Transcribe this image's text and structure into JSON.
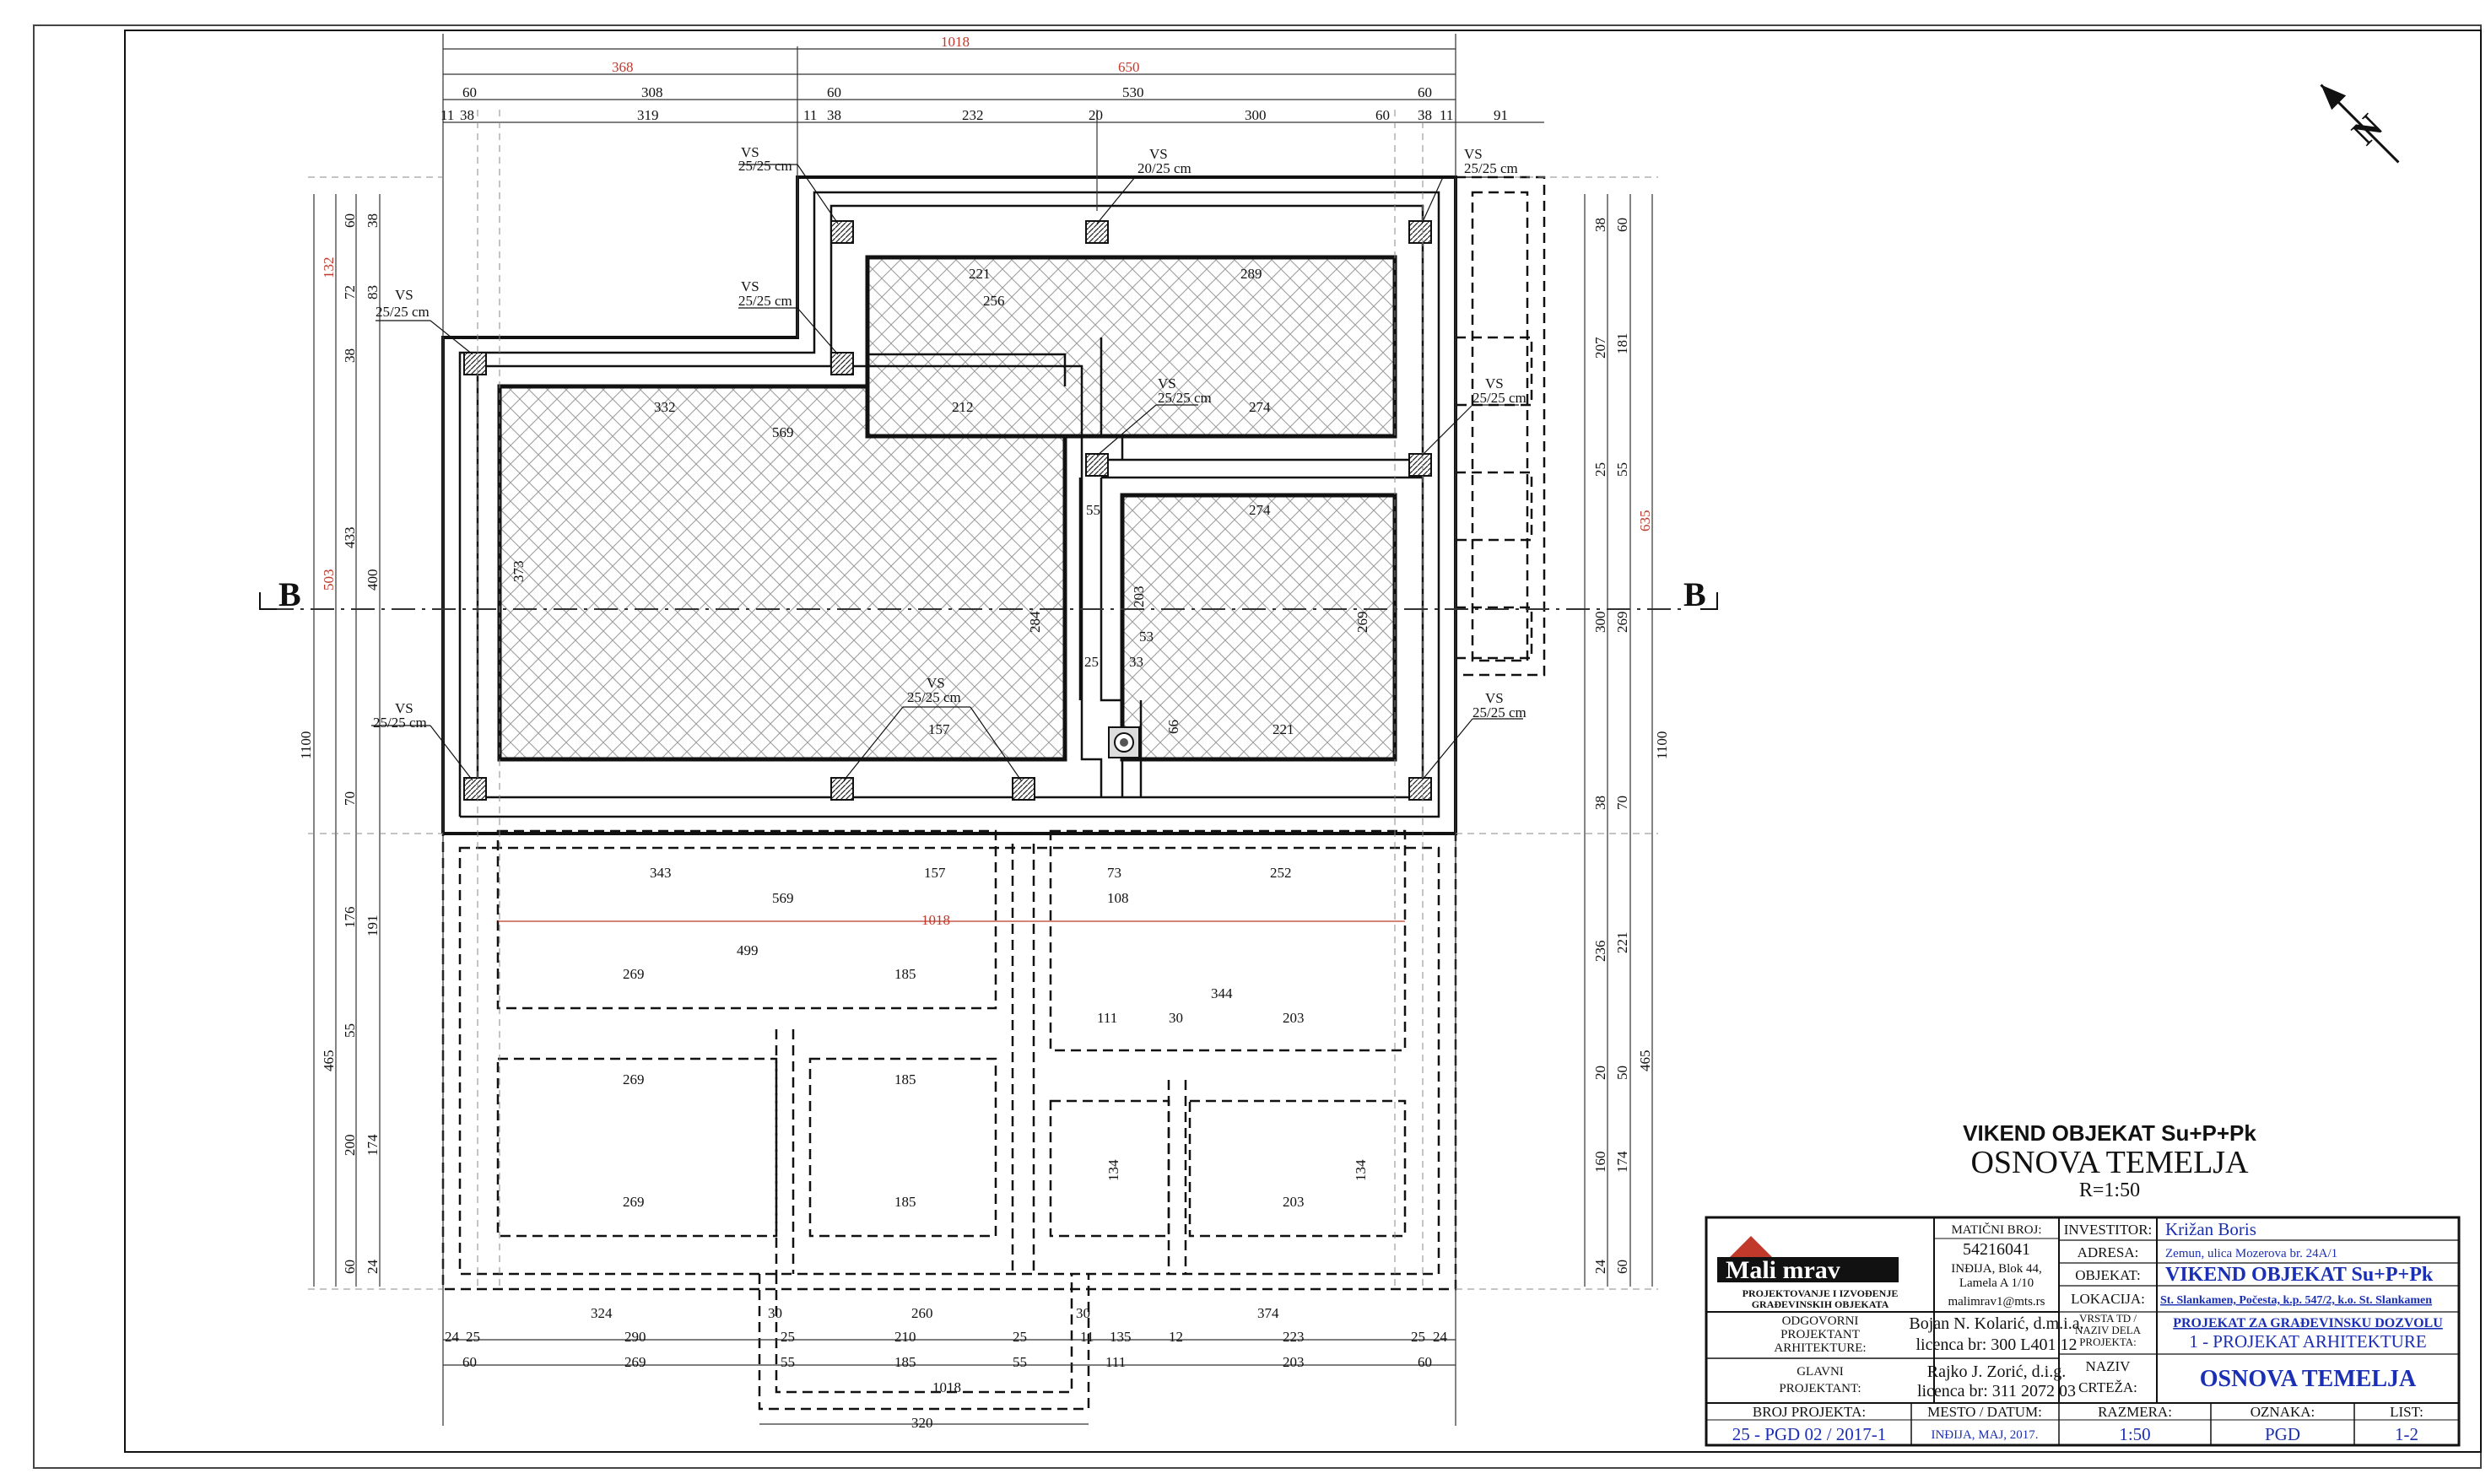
{
  "drawing": {
    "dims_top": {
      "overall": "1018",
      "part_a": "368",
      "part_b": "650",
      "row3": [
        "60",
        "308",
        "60",
        "530",
        "60"
      ],
      "row4": [
        "11",
        "38",
        "319",
        "11",
        "38",
        "232",
        "20",
        "300",
        "60",
        "38",
        "11",
        "91"
      ]
    },
    "dims_left": {
      "overall": "1100",
      "red_a": "132",
      "red_b": "503",
      "row": [
        "60",
        "72",
        "38",
        "433",
        "70",
        "176",
        "465",
        "55",
        "200",
        "60"
      ],
      "row2": [
        "38",
        "83",
        "400",
        "191",
        "174",
        "24"
      ]
    },
    "dims_right": {
      "overall": "1100",
      "red_a": "635",
      "row": [
        "60",
        "181",
        "55",
        "269",
        "70",
        "221",
        "465",
        "50",
        "174",
        "60"
      ],
      "row2": [
        "38",
        "207",
        "25",
        "300",
        "38",
        "236",
        "20",
        "160",
        "24"
      ]
    },
    "dims_bottom": {
      "row1": [
        "324",
        "30",
        "260",
        "30",
        "374"
      ],
      "row2": [
        "24",
        "25",
        "290",
        "25",
        "210",
        "25",
        "11",
        "135",
        "12",
        "223",
        "25",
        "24"
      ],
      "row3": [
        "60",
        "269",
        "55",
        "185",
        "55",
        "111",
        "203",
        "60"
      ],
      "overall": "1018",
      "foot": "320"
    },
    "interior_labels": [
      "332",
      "569",
      "212",
      "373",
      "284",
      "221",
      "256",
      "289",
      "274",
      "274",
      "203",
      "269",
      "157",
      "221",
      "343",
      "157",
      "569",
      "499",
      "269",
      "185",
      "269",
      "185",
      "269",
      "185",
      "344",
      "203",
      "134",
      "134",
      "203",
      "108",
      "252",
      "73",
      "111",
      "30",
      "55",
      "25",
      "66",
      "53",
      "33"
    ],
    "red_center_dim": "1018",
    "section_marker": "B",
    "column_tag": "VS",
    "column_sizes": [
      "25/25 cm",
      "20/25 cm"
    ],
    "north": "N"
  },
  "title": {
    "line1": "VIKEND OBJEKAT Su+P+Pk",
    "line2": "OSNOVA TEMELJA",
    "scale": "R=1:50"
  },
  "titleblock": {
    "logo": "Mali mrav",
    "logo_sub1": "PROJEKTOVANJE I IZVOĐENJE",
    "logo_sub2": "GRAĐEVINSKIH OBJEKATA",
    "maticni_label": "MATIČNI BROJ:",
    "maticni_value": "54216041",
    "address_1": "INĐIJA, Blok 44,",
    "address_2": "Lamela A 1/10",
    "email": "malimrav1@mts.rs",
    "odgovorni_label_1": "ODGOVORNI",
    "odgovorni_label_2": "PROJEKTANT",
    "odgovorni_label_3": "ARHITEKTURE:",
    "odgovorni_name": "Bojan N. Kolarić, d.m.i.a.",
    "odgovorni_lic": "licenca br: 300 L401 12",
    "glavni_label_1": "GLAVNI",
    "glavni_label_2": "PROJEKTANT:",
    "glavni_name": "Rajko J. Zorić, d.i.g.",
    "glavni_lic": "licenca br: 311 2072 03",
    "investitor_label": "INVESTITOR:",
    "investitor_value": "Križan Boris",
    "adresa_label": "ADRESA:",
    "adresa_value": "Zemun, ulica Mozerova br. 24A/1",
    "objekat_label": "OBJEKAT:",
    "objekat_value": "VIKEND OBJEKAT  Su+P+Pk",
    "lokacija_label": "LOKACIJA:",
    "lokacija_value": "St. Slankamen, Počesta, k.p. 547/2, k.o. St. Slankamen",
    "vrsta_label_1": "VRSTA TD /",
    "vrsta_label_2": "NAZIV DELA",
    "vrsta_label_3": "PROJEKTA:",
    "vrsta_value_1": "PROJEKAT ZA GRAĐEVINSKU DOZVOLU",
    "vrsta_value_2": "1 - PROJEKAT ARHITEKTURE",
    "naziv_label_1": "NAZIV",
    "naziv_label_2": "CRTEŽA:",
    "naziv_value": "OSNOVA TEMELJA",
    "broj_label": "BROJ PROJEKTA:",
    "broj_value": "25 - PGD 02 / 2017-1",
    "mesto_label": "MESTO / DATUM:",
    "mesto_value": "INĐIJA, MAJ, 2017.",
    "razmera_label": "RAZMERA:",
    "razmera_value": "1:50",
    "oznaka_label": "OZNAKA:",
    "oznaka_value": "PGD",
    "list_label": "LIST:",
    "list_value": "1-2"
  }
}
